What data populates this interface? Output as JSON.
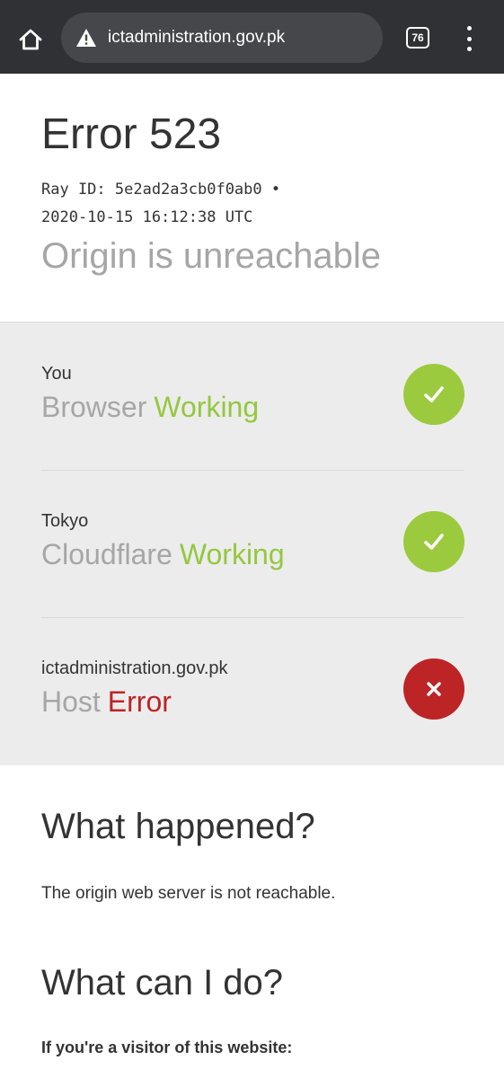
{
  "browser": {
    "url": "ictadministration.gov.pk",
    "tab_count": "76",
    "icons": {
      "home": "home-icon",
      "warning": "warning-icon",
      "menu": "more-vert-icon"
    }
  },
  "error": {
    "title": "Error 523",
    "ray_line1": "Ray ID: 5e2ad2a3cb0f0ab0 •",
    "ray_line2": "2020-10-15 16:12:38 UTC",
    "subtitle": "Origin is unreachable"
  },
  "status": {
    "rows": [
      {
        "location": "You",
        "kind": "Browser",
        "state": "Working",
        "ok": true
      },
      {
        "location": "Tokyo",
        "kind": "Cloudflare",
        "state": "Working",
        "ok": true
      },
      {
        "location": "ictadministration.gov.pk",
        "kind": "Host",
        "state": "Error",
        "ok": false
      }
    ],
    "colors": {
      "working": "#93c83e",
      "error": "#bd2426"
    }
  },
  "what_happened": {
    "heading": "What happened?",
    "text": "The origin web server is not reachable."
  },
  "what_can_i_do": {
    "heading": "What can I do?",
    "visitor_label": "If you're a visitor of this website:"
  }
}
